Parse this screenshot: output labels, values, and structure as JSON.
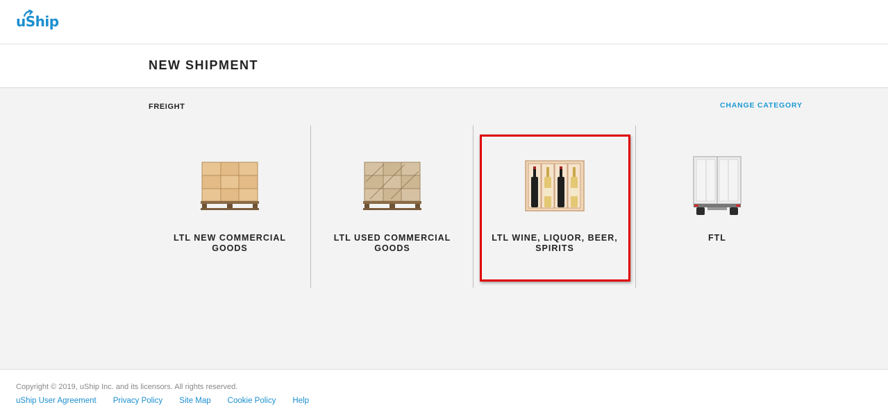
{
  "header": {
    "logo_text": "uShip"
  },
  "page": {
    "title": "NEW SHIPMENT"
  },
  "category": {
    "label": "FREIGHT",
    "change_link": "CHANGE CATEGORY"
  },
  "cards": [
    {
      "label": "LTL NEW COMMERCIAL GOODS",
      "icon": "new-pallet-boxes-icon"
    },
    {
      "label": "LTL USED COMMERCIAL GOODS",
      "icon": "used-pallet-boxes-icon"
    },
    {
      "label": "LTL WINE, LIQUOR, BEER, SPIRITS",
      "icon": "wine-bottles-crate-icon"
    },
    {
      "label": "FTL",
      "icon": "truck-rear-icon"
    }
  ],
  "highlight": {
    "target": "card-ltl-wine",
    "color": "#e00000"
  },
  "footer": {
    "copyright": "Copyright © 2019, uShip Inc. and its licensors. All rights reserved.",
    "links": [
      "uShip User Agreement",
      "Privacy Policy",
      "Site Map",
      "Cookie Policy",
      "Help"
    ]
  },
  "colors": {
    "brand": "#1b8fd0",
    "link": "#1b9ad6",
    "background": "#f3f3f3"
  }
}
